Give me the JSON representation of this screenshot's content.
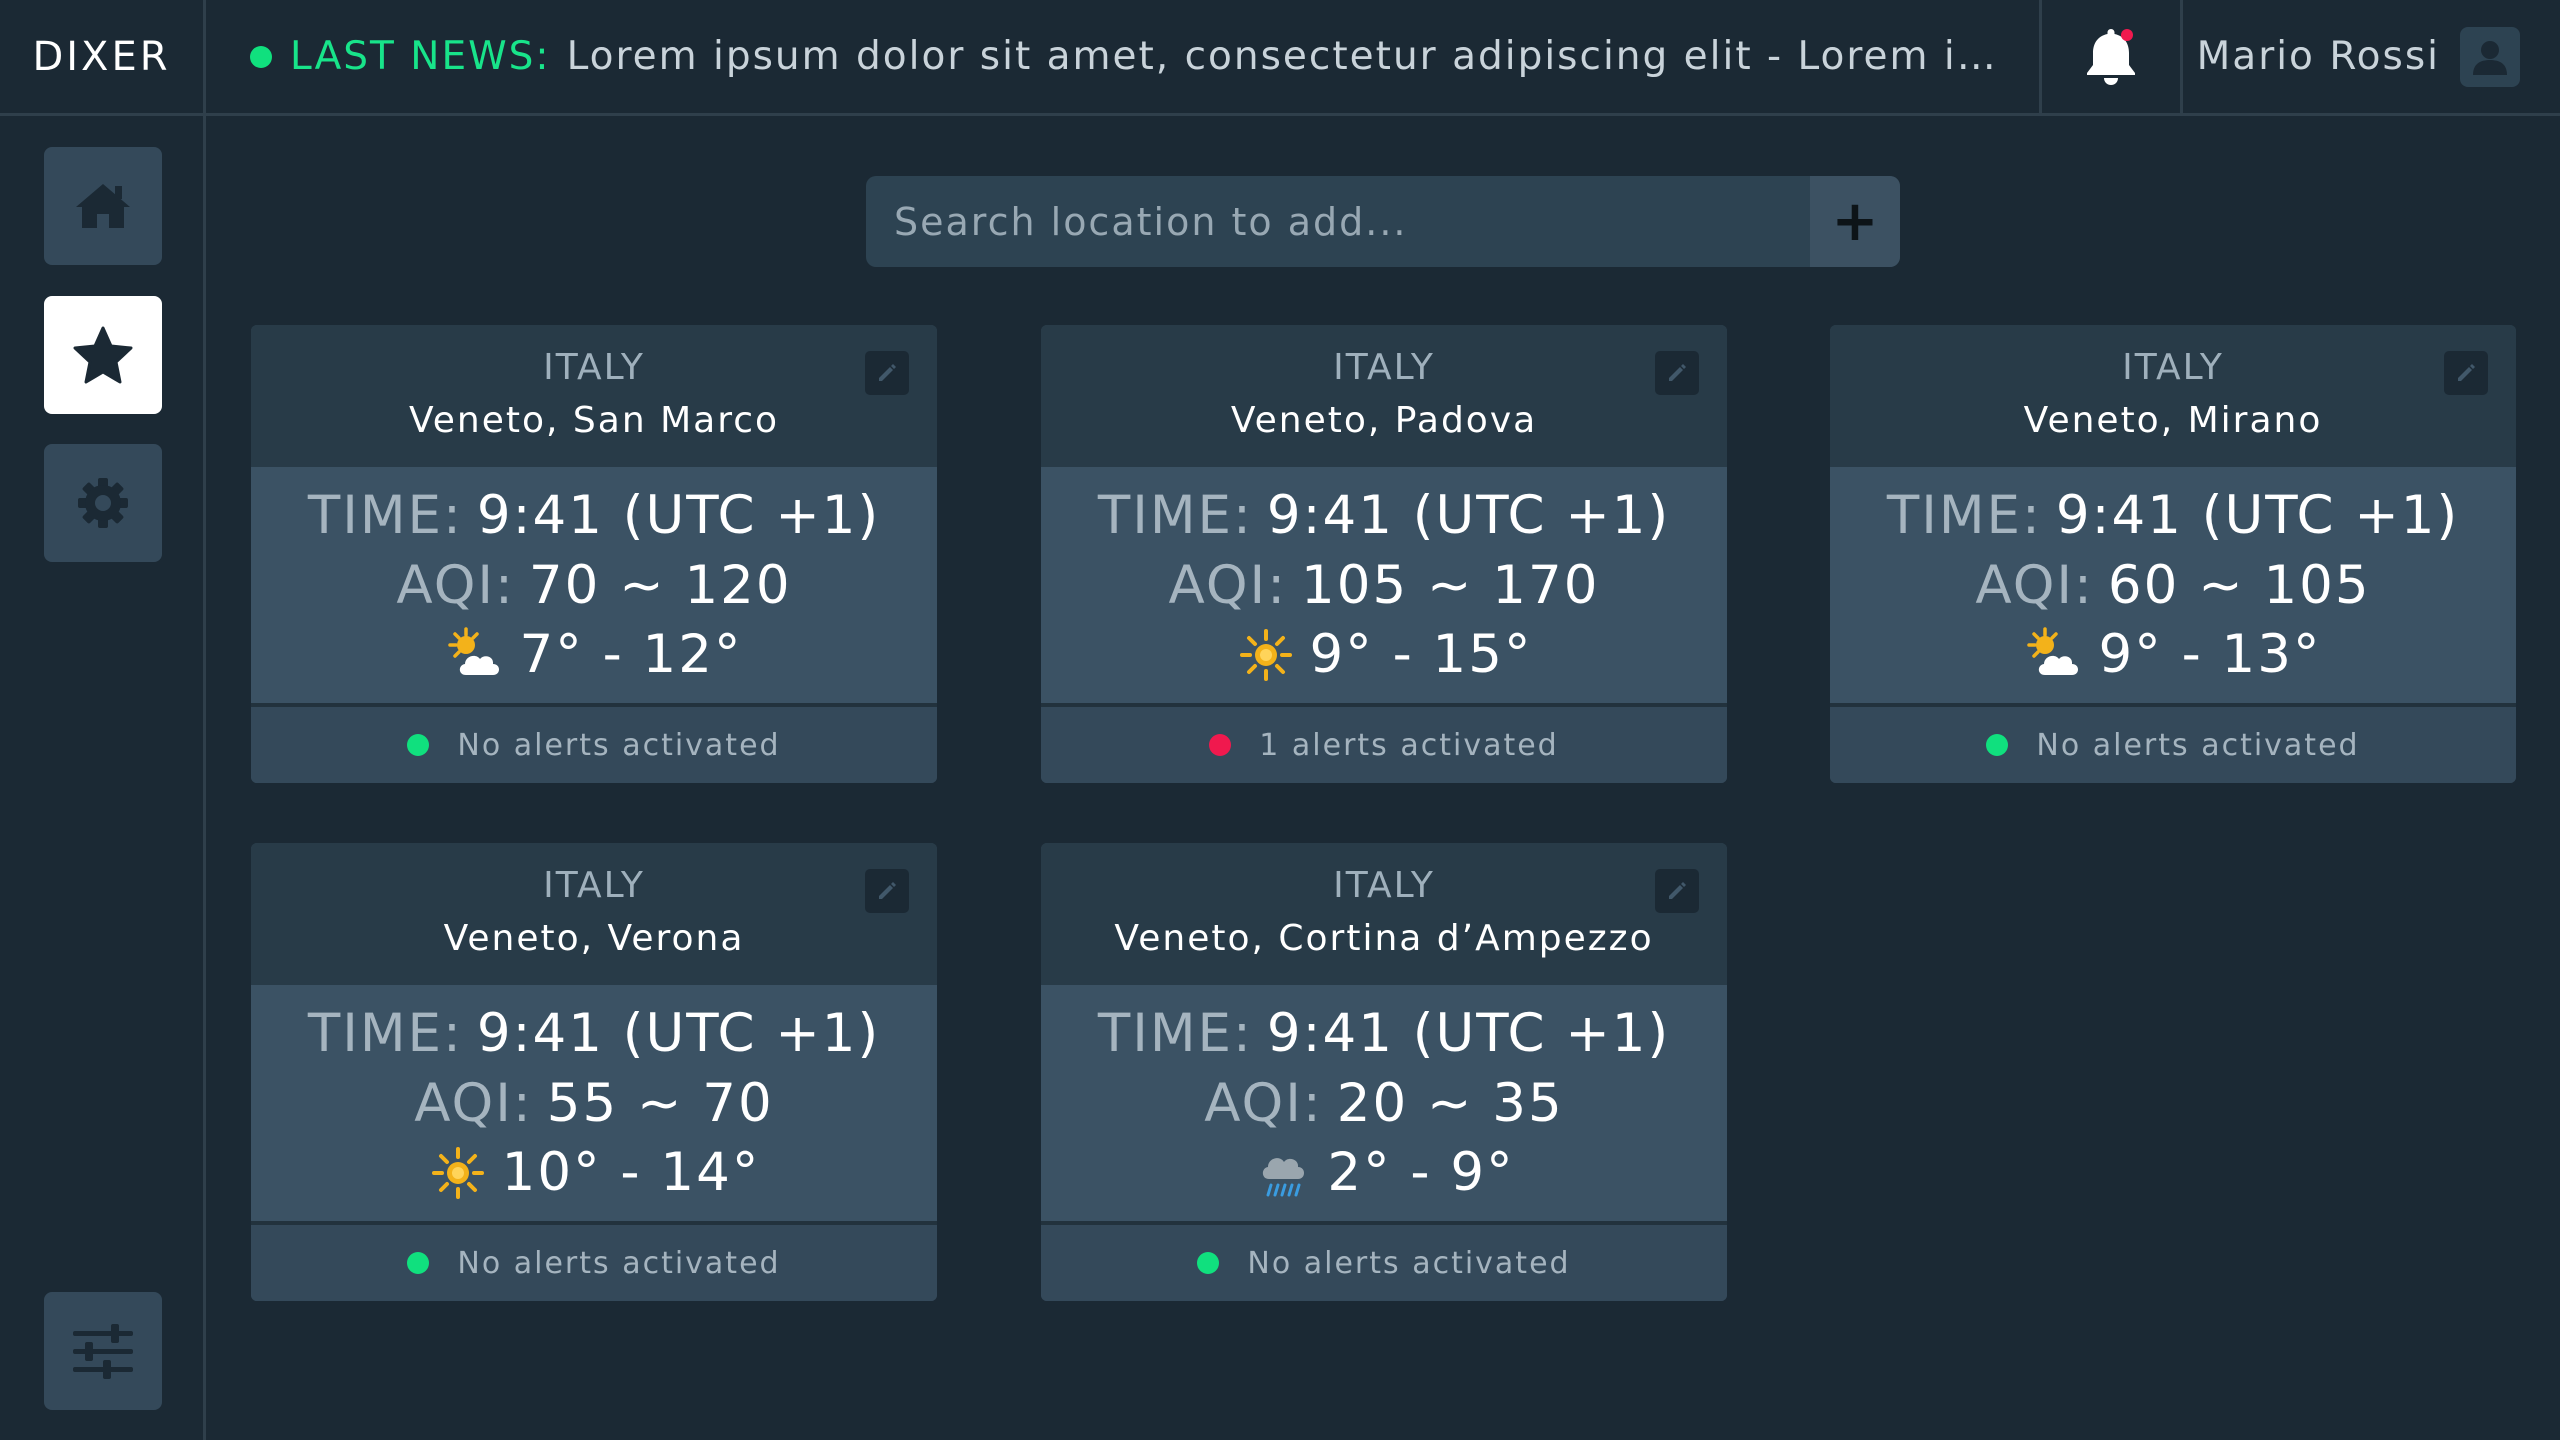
{
  "app": {
    "brand": "DIXER"
  },
  "news": {
    "label": "LAST NEWS:",
    "text": "Lorem ipsum dolor sit amet, consectetur adipiscing elit  -  Lorem ipsum dolor sit amet, consectetur adipiscing elit"
  },
  "user": {
    "name": "Mario Rossi"
  },
  "search": {
    "placeholder": "Search location to add...",
    "add_label": "+"
  },
  "cards": [
    {
      "country": "ITALY",
      "place": "Veneto, San Marco",
      "time_key": "TIME:",
      "time": "9:41 (UTC +1)",
      "aqi_key": "AQI:",
      "aqi": "70 ~ 120",
      "weather_icon": "partly-cloudy-icon",
      "temp": "7° - 12°",
      "alerts": "No alerts activated",
      "alert_color": "#10e07e"
    },
    {
      "country": "ITALY",
      "place": "Veneto, Padova",
      "time_key": "TIME:",
      "time": "9:41 (UTC +1)",
      "aqi_key": "AQI:",
      "aqi": "105 ~ 170",
      "weather_icon": "sun-icon",
      "temp": "9° - 15°",
      "alerts": "1 alerts activated",
      "alert_color": "#f0194e"
    },
    {
      "country": "ITALY",
      "place": "Veneto, Mirano",
      "time_key": "TIME:",
      "time": "9:41 (UTC +1)",
      "aqi_key": "AQI:",
      "aqi": "60 ~ 105",
      "weather_icon": "partly-cloudy-icon",
      "temp": "9° - 13°",
      "alerts": "No alerts activated",
      "alert_color": "#10e07e"
    },
    {
      "country": "ITALY",
      "place": "Veneto, Verona",
      "time_key": "TIME:",
      "time": "9:41 (UTC +1)",
      "aqi_key": "AQI:",
      "aqi": "55 ~ 70",
      "weather_icon": "sun-icon",
      "temp": "10° - 14°",
      "alerts": "No alerts activated",
      "alert_color": "#10e07e"
    },
    {
      "country": "ITALY",
      "place": "Veneto, Cortina d’Ampezzo",
      "time_key": "TIME:",
      "time": "9:41 (UTC +1)",
      "aqi_key": "AQI:",
      "aqi": "20 ~ 35",
      "weather_icon": "rain-cloud-icon",
      "temp": "2° - 9°",
      "alerts": "No alerts activated",
      "alert_color": "#10e07e"
    }
  ],
  "colors": {
    "background": "#1b2934",
    "accent_green": "#18e48a",
    "alert_red": "#f0194e",
    "card_header": "#283b48",
    "card_body": "#3b5264"
  }
}
